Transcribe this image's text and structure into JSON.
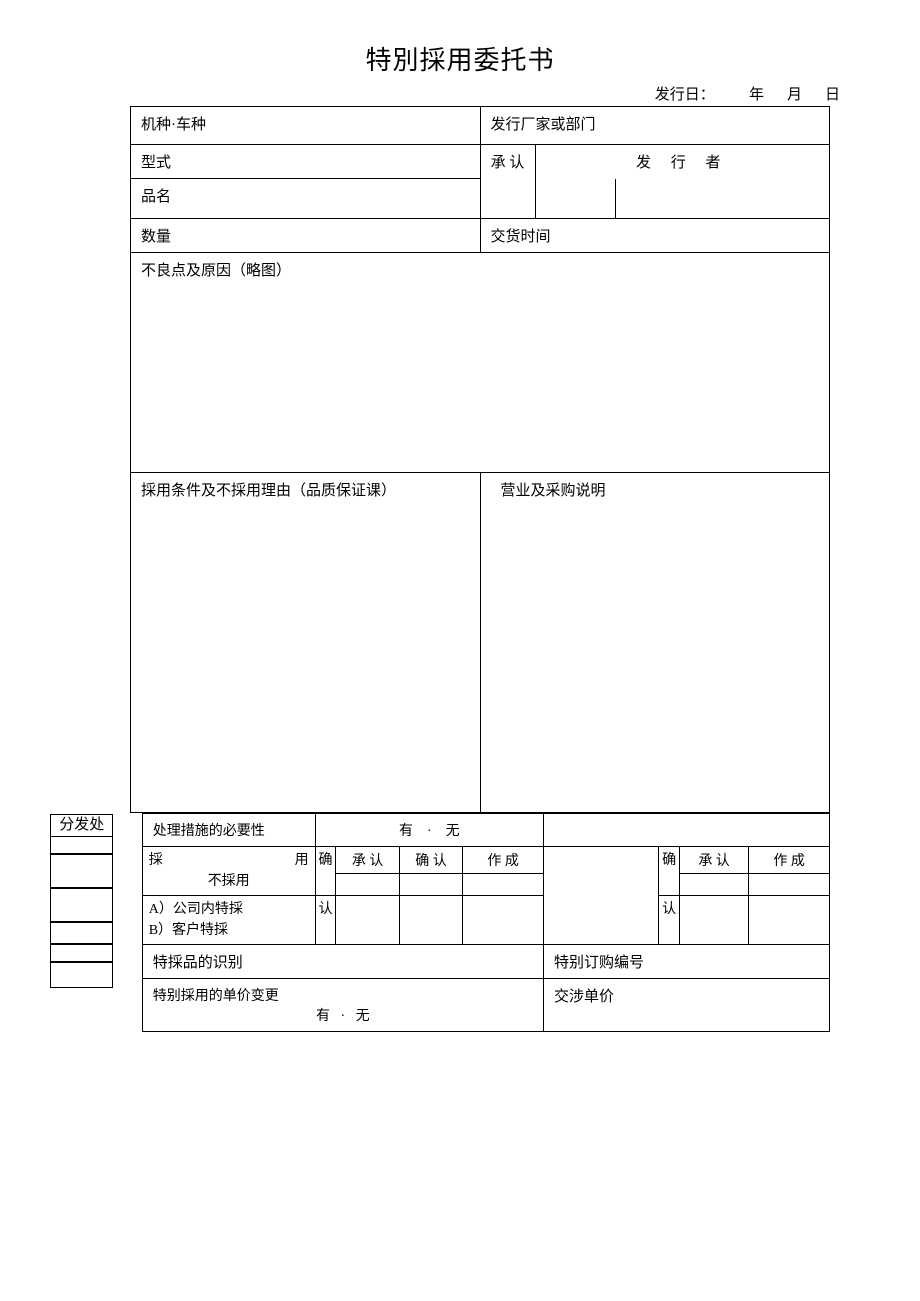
{
  "title": "特別採用委托书",
  "issue": {
    "prefix": "发行日：",
    "year": "年",
    "month": "月",
    "day": "日"
  },
  "r1": {
    "model_type": "机种·车种",
    "issuer_dept": "发行厂家或部门"
  },
  "r2": {
    "style": "型式",
    "approve": "承 认",
    "issuer": "发 行 者"
  },
  "r3": {
    "name": "品名"
  },
  "r4": {
    "qty": "数量",
    "delivery": "交货时间"
  },
  "defect": "不良点及原因（略图）",
  "cond": "採用条件及不採用理由（品质保证课）",
  "sales": "营业及采购说明",
  "dist": "分发处",
  "necessity": {
    "label": "处理措施的必要性",
    "yes": "有",
    "dot": "·",
    "no": "无"
  },
  "adopt": {
    "line1a": "採",
    "line1b": "用",
    "line2": "不採用",
    "line3": "A）公司内特採",
    "line4": "B）客户特採",
    "confirm_v": "确认",
    "h1": "承 认",
    "h2": "确 认",
    "h3": "作  成",
    "rh1": "承 认",
    "rh2": "作  成"
  },
  "ident": "特採品的识别",
  "order_no": "特别订购编号",
  "price_change": {
    "label": "特别採用的单价变更",
    "yes": "有",
    "dot": "·",
    "no": "无"
  },
  "nego_price": "交涉单价"
}
